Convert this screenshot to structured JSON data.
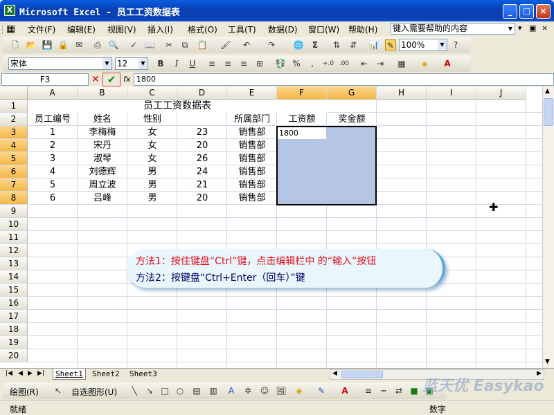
{
  "window": {
    "title": "Microsoft Excel - 员工工资数据表",
    "app_icon": "excel-icon",
    "buttons": [
      "minimize",
      "maximize",
      "close"
    ]
  },
  "menu": {
    "items": [
      "文件(F)",
      "编辑(E)",
      "视图(V)",
      "插入(I)",
      "格式(O)",
      "工具(T)",
      "数据(D)",
      "窗口(W)",
      "帮助(H)"
    ],
    "help_box_value": "键入需要帮助的内容"
  },
  "toolbar": {
    "zoom": "100%",
    "font_name": "宋体",
    "font_size": "12",
    "bold": "B",
    "italic": "I",
    "underline": "U",
    "percent": "%",
    "comma": ","
  },
  "formula_bar": {
    "name_box": "F3",
    "fx": "fx",
    "value": "1800"
  },
  "sheet": {
    "columns": [
      "A",
      "B",
      "C",
      "D",
      "E",
      "F",
      "G",
      "H",
      "I",
      "J"
    ],
    "rows": [
      "1",
      "2",
      "3",
      "4",
      "5",
      "6",
      "7",
      "8",
      "9",
      "10",
      "11",
      "12",
      "13",
      "14",
      "15",
      "16",
      "17",
      "18",
      "19",
      "20"
    ],
    "title": "员工工资数据表",
    "headers": [
      "员工编号",
      "姓名",
      "性别",
      "",
      "所属部门",
      "工资额",
      "奖金额"
    ],
    "data": [
      [
        "1",
        "李梅梅",
        "女",
        "23",
        "销售部"
      ],
      [
        "2",
        "宋丹",
        "女",
        "20",
        "销售部"
      ],
      [
        "3",
        "淑琴",
        "女",
        "26",
        "销售部"
      ],
      [
        "4",
        "刘德辉",
        "男",
        "24",
        "销售部"
      ],
      [
        "5",
        "周立波",
        "男",
        "21",
        "销售部"
      ],
      [
        "6",
        "吕峰",
        "男",
        "20",
        "销售部"
      ]
    ],
    "active_value": "1800"
  },
  "callout": {
    "line1": "方法1：按住键盘“Ctrl”键，点击编辑栏中 的“输入”按钮",
    "line2": "方法2：按键盘“Ctrl+Enter（回车）”键"
  },
  "sheet_tabs": [
    "Sheet1",
    "Sheet2",
    "Sheet3"
  ],
  "draw_bar": {
    "draw_label": "绘图(R)",
    "autoshape_label": "自选图形(U)"
  },
  "status": {
    "left": "就绪",
    "right": "数字"
  },
  "watermark": "蓝天优 Easykao"
}
